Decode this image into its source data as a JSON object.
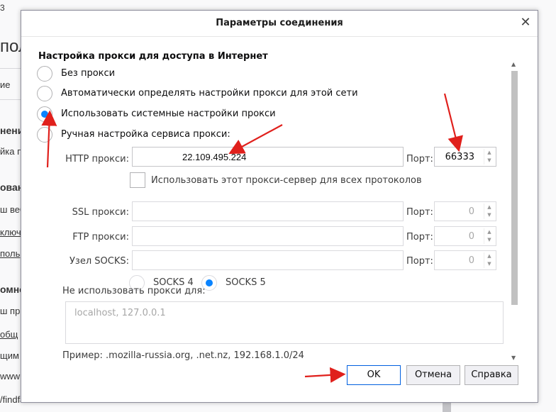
{
  "background": {
    "fragments": [
      "3",
      "пол",
      "ие",
      "нени",
      "йка п",
      "ован",
      "ш веб",
      "ключ",
      "поль",
      "омно",
      "ш пр",
      "общ",
      "щим",
      "www",
      "/findfacet.ru"
    ]
  },
  "dialog": {
    "title": "Параметры соединения",
    "close_glyph": "✕",
    "group_title": "Настройка прокси для доступа в Интернет",
    "radios": {
      "none": "Без прокси",
      "auto_detect": "Автоматически определять настройки прокси для этой сети",
      "system": "Использовать системные настройки прокси",
      "manual": "Ручная настройка сервиса прокси:"
    },
    "http": {
      "label": "HTTP прокси:",
      "value": "22.109.495.224",
      "port_label": "Порт:",
      "port": "66333"
    },
    "all_protocols_label": "Использовать этот прокси-сервер для всех протоколов",
    "ssl": {
      "label": "SSL прокси:",
      "value": "",
      "port_label": "Порт:",
      "port": "0"
    },
    "ftp": {
      "label": "FTP прокси:",
      "value": "",
      "port_label": "Порт:",
      "port": "0"
    },
    "socks": {
      "label": "Узел SOCKS:",
      "value": "",
      "port_label": "Порт:",
      "port": "0"
    },
    "socks_versions": {
      "v4": "SOCKS 4",
      "v5": "SOCKS 5",
      "selected": "SOCKS 5"
    },
    "no_proxy_label": "Не использовать прокси для:",
    "no_proxy_value": "localhost, 127.0.0.1",
    "example": "Пример: .mozilla-russia.org, .net.nz, 192.168.1.0/24",
    "selected_option": "system",
    "buttons": {
      "ok": "OK",
      "cancel": "Отмена",
      "help": "Справка"
    }
  },
  "colors": {
    "accent": "#0a84ff",
    "annotation": "#e0201c",
    "dialog_border": "#8f8f9d"
  },
  "icons": {
    "close": "close-icon",
    "spin": "spin-arrows-icon",
    "annotation": "red-arrow"
  }
}
